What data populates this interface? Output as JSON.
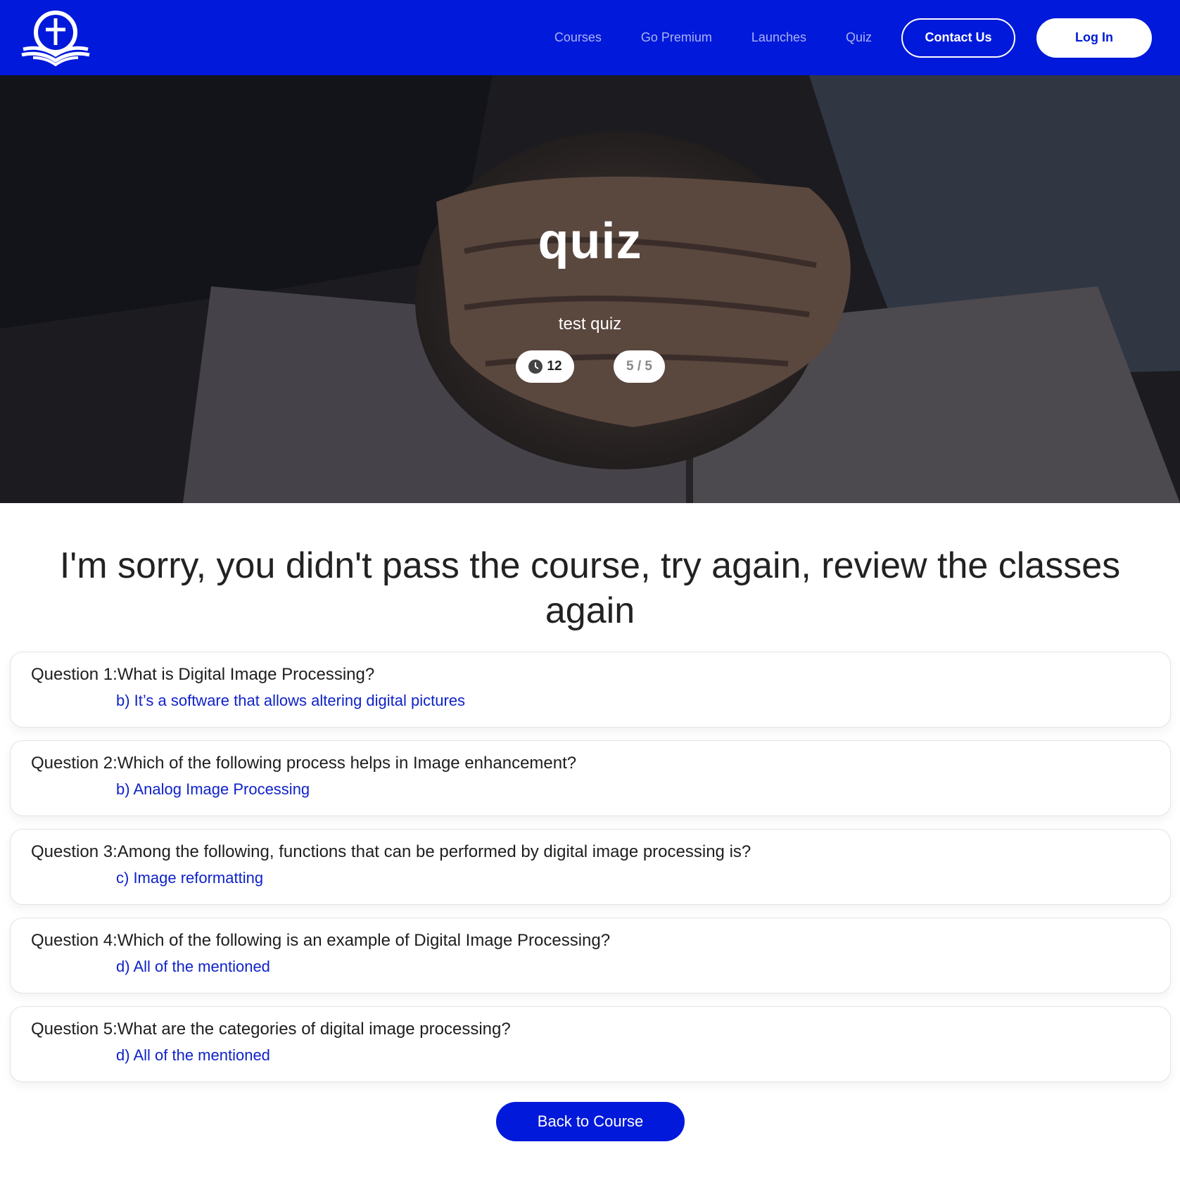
{
  "header": {
    "brand_color": "#0019da",
    "nav": {
      "courses": "Courses",
      "premium": "Go Premium",
      "launches": "Launches",
      "quiz": "Quiz"
    },
    "contact_label": "Contact Us",
    "login_label": "Log In"
  },
  "hero": {
    "title": "quiz",
    "subtitle": "test quiz",
    "time_value": "12",
    "score_value": "5 / 5"
  },
  "result": {
    "message": "I'm sorry, you didn't pass the course, try again, review the classes again"
  },
  "questions": [
    {
      "text": "Question 1:What is Digital Image Processing?",
      "answer": "b) It’s a software that allows altering digital pictures"
    },
    {
      "text": "Question 2:Which of the following process helps in Image enhancement?",
      "answer": "b) Analog Image Processing"
    },
    {
      "text": "Question 3:Among the following, functions that can be performed by digital image processing is?",
      "answer": "c) Image reformatting"
    },
    {
      "text": "Question 4:Which of the following is an example of Digital Image Processing?",
      "answer": "d) All of the mentioned"
    },
    {
      "text": "Question 5:What are the categories of digital image processing?",
      "answer": "d) All of the mentioned"
    }
  ],
  "footer": {
    "back_label": "Back to Course"
  }
}
